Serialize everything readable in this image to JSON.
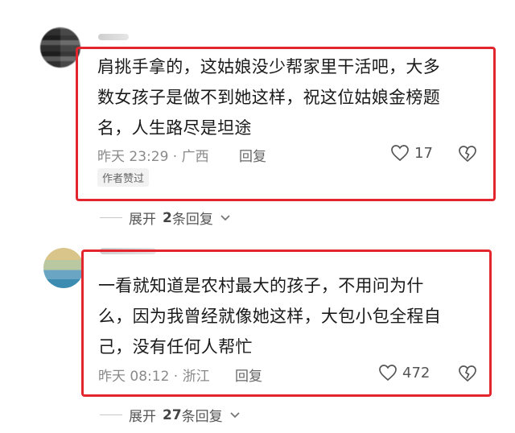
{
  "comments": [
    {
      "lines": [
        "肩挑手拿的，这姑娘没少帮家里干活吧，大多",
        "数女孩子是做不到她这样，祝这位姑娘金榜题",
        "名，人生路尽是坦途"
      ],
      "time": "昨天 23:29 · 广西",
      "reply_label": "回复",
      "likes": "17",
      "author_badge": "作者赞过",
      "expand_prefix": "展开",
      "expand_count": "2",
      "expand_suffix": "条回复"
    },
    {
      "lines": [
        "一看就知道是农村最大的孩子，不用问为什",
        "么，因为我曾经就像她这样，大包小包全程自",
        "己，没有任何人帮忙"
      ],
      "time": "昨天 08:12 · 浙江",
      "reply_label": "回复",
      "likes": "472",
      "expand_prefix": "展开",
      "expand_count": "27",
      "expand_suffix": "条回复"
    }
  ],
  "colors": {
    "highlight_box": "#e3262d",
    "meta": "#8a8a8a"
  },
  "icons": {
    "like": "heart-outline-icon",
    "dislike": "broken-heart-icon",
    "expand": "chevron-down-icon"
  }
}
